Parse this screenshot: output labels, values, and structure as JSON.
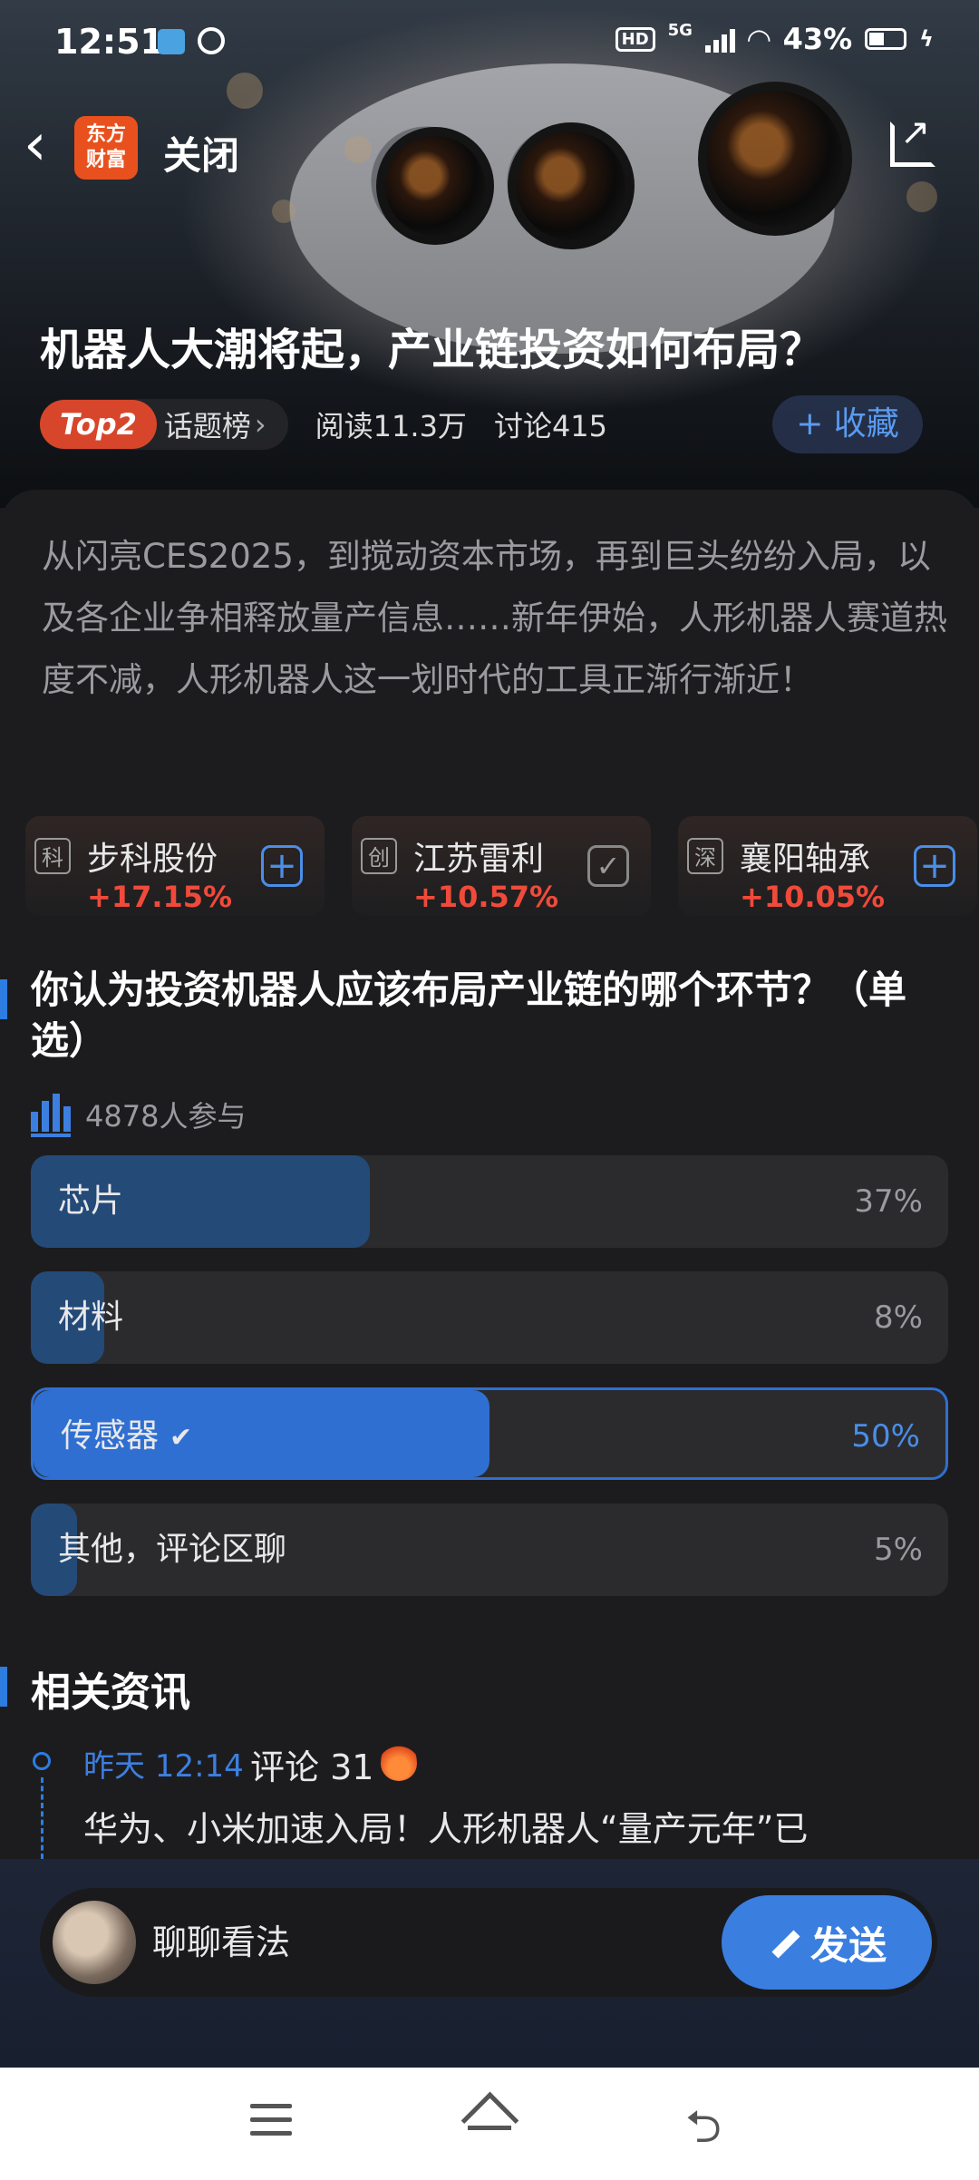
{
  "status_bar": {
    "time": "12:51",
    "network": "5G",
    "hd": "HD",
    "battery": "43%"
  },
  "nav": {
    "back_glyph": "‹",
    "logo_text": "东方\n财富",
    "close_label": "关闭"
  },
  "topic": {
    "title": "机器人大潮将起，产业链投资如何布局？",
    "rank_badge": "Top2",
    "rank_label": "话题榜",
    "reads": "阅读11.3万",
    "discussions": "讨论415",
    "favorite_label": "+ 收藏",
    "intro": "从闪亮CES2025，到搅动资本市场，再到巨头纷纷入局，以及各企业争相释放量产信息……新年伊始，人形机器人赛道热度不减，人形机器人这一划时代的工具正渐行渐近！"
  },
  "stocks": [
    {
      "badge": "科",
      "name": "步科股份",
      "change": "+17.15%",
      "added": false
    },
    {
      "badge": "创",
      "name": "江苏雷利",
      "change": "+10.57%",
      "added": true
    },
    {
      "badge": "深",
      "name": "襄阳轴承",
      "change": "+10.05%",
      "added": false
    }
  ],
  "poll": {
    "question": "你认为投资机器人应该布局产业链的哪个环节？（单选）",
    "participants": "4878人参与",
    "options": [
      {
        "label": "芯片",
        "percent": "37%",
        "value": 37,
        "selected": false
      },
      {
        "label": "材料",
        "percent": "8%",
        "value": 8,
        "selected": false
      },
      {
        "label": "传感器",
        "percent": "50%",
        "value": 50,
        "selected": true
      },
      {
        "label": "其他，评论区聊",
        "percent": "5%",
        "value": 5,
        "selected": false
      }
    ]
  },
  "news": {
    "heading": "相关资讯",
    "items": [
      {
        "time": "昨天 12:14",
        "comments": "评论 31",
        "title": "华为、小米加速入局！人形机器人“量产元年”已"
      }
    ]
  },
  "composer": {
    "placeholder": "聊聊看法",
    "send_label": "发送"
  },
  "colors": {
    "accent": "#2f6fd1",
    "up": "#f04a3a",
    "logo": "#e8511e"
  },
  "icons": [
    "back-icon",
    "share-icon",
    "add-icon",
    "check-icon",
    "poll-bars-icon",
    "fire-icon",
    "pen-icon",
    "menu-icon",
    "home-icon",
    "return-icon"
  ]
}
